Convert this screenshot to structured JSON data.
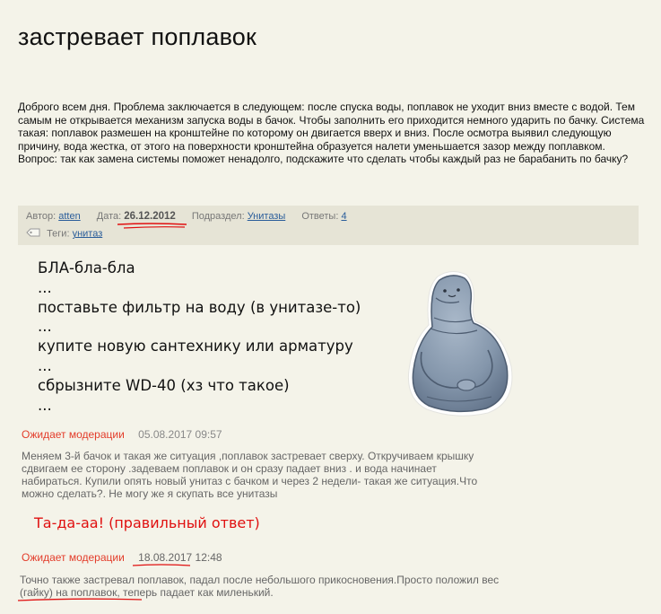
{
  "post": {
    "title": "застревает поплавок",
    "body": "Доброго всем дня. Проблема заключается в следующем: после спуска воды, поплавок не уходит вниз вместе с водой. Тем самым не открывается механизм запуска воды в бачок.  Чтобы заполнить его приходится немного ударить по бачку. Система такая: поплавок размешен на кронштейне по которому он двигается вверх и вниз. После осмотра выявил следующую причину, вода жестка, от этого на поверхности кронштейна образуется налети уменьшается зазор между поплавком. Вопрос: так как замена системы поможет ненадолго, подскажите что сделать чтобы каждый раз не барабанить по бачку?"
  },
  "meta": {
    "author_label": "Автор:",
    "author": "atten",
    "date_label": "Дата:",
    "date": "26.12.2012",
    "section_label": "Подраздел:",
    "section": "Унитазы",
    "answers_label": "Ответы:",
    "answers": "4",
    "tags_label": "Теги:",
    "tag": "унитаз"
  },
  "joke_lines": [
    "БЛА-бла-бла",
    "...",
    "поставьте фильтр на воду (в унитазе-то)",
    "...",
    "купите новую сантехнику или арматуру",
    "...",
    "сбрызните WD-40 (хз что такое)",
    "..."
  ],
  "comments": [
    {
      "status": "Ожидает модерации",
      "time": "05.08.2017 09:57",
      "text": "Меняем 3-й бачок и такая же ситуация ,поплавок застревает сверху. Откручиваем крышку сдвигаем ее сторону .задеваем поплавок и он сразу падает вниз . и вода начинает набираться. Купили опять новый унитаз с бачком и через 2 недели- такая же ситуация.Что можно сделать?. Не могу же я скупать все унитазы"
    },
    {
      "status": "Ожидает модерации",
      "time": "18.08.2017 12:48",
      "text": "Точно также застревал поплавок, падал после небольшого прикосновения.Просто положил вес (гайку) на поплавок, теперь падает как миленький."
    }
  ],
  "annotation": "Та-да-аа! (правильный ответ)",
  "colors": {
    "background": "#f4f3e9",
    "meta_bar": "#e6e4d6",
    "link": "#2a5d9a",
    "moderation": "#e33c2a",
    "annotation_red": "#e01010"
  }
}
